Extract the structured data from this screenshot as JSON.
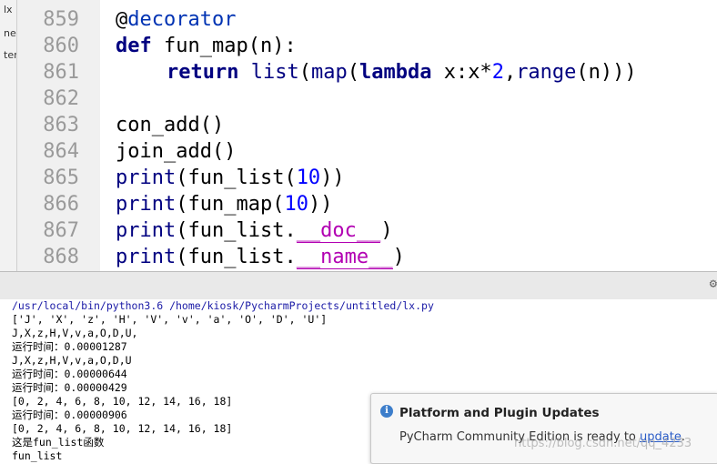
{
  "project_tree": {
    "items": [
      "lx",
      "ne",
      "ter"
    ]
  },
  "editor": {
    "line_numbers": [
      "859",
      "860",
      "861",
      "862",
      "863",
      "864",
      "865",
      "866",
      "867",
      "868"
    ],
    "lines": {
      "l859": {
        "at": "@",
        "name": "decorator"
      },
      "l860": {
        "kw": "def",
        "rest": " fun_map(n):"
      },
      "l861": {
        "kw": "return",
        "list": "list",
        "p1": "(",
        "map": "map",
        "p2": "(",
        "lambda": "lambda",
        "mid": " x:x*",
        "two": "2",
        "comma": ",",
        "range": "range",
        "end": "(n)))"
      },
      "l863": "con_add()",
      "l864": "join_add()",
      "l865": {
        "fn": "print",
        "mid": "(fun_list(",
        "num": "10",
        "end": "))"
      },
      "l866": {
        "fn": "print",
        "mid": "(fun_map(",
        "num": "10",
        "end": "))"
      },
      "l867": {
        "fn": "print",
        "mid": "(fun_list.",
        "magic": "__doc__",
        "end": ")"
      },
      "l868": {
        "fn": "print",
        "mid": "(fun_list.",
        "magic": "__name__",
        "end": ")"
      }
    }
  },
  "console": {
    "lines": [
      "/usr/local/bin/python3.6 /home/kiosk/PycharmProjects/untitled/lx.py",
      "['J', 'X', 'z', 'H', 'V', 'v', 'a', 'O', 'D', 'U']",
      "J,X,z,H,V,v,a,O,D,U,",
      "运行时间：0.00001287",
      "J,X,z,H,V,v,a,O,D,U",
      "运行时间：0.00000644",
      "运行时间：0.00000429",
      "[0, 2, 4, 6, 8, 10, 12, 14, 16, 18]",
      "运行时间：0.00000906",
      "[0, 2, 4, 6, 8, 10, 12, 14, 16, 18]",
      "这是fun_list函数",
      "fun_list"
    ]
  },
  "notification": {
    "title": "Platform and Plugin Updates",
    "body_prefix": "PyCharm Community Edition is ready to ",
    "link": "update",
    "body_suffix": "."
  },
  "watermark": "https://blog.csdn.net/qq_4233",
  "icons": {
    "gear": "gear-icon",
    "info": "info-icon"
  },
  "colors": {
    "keyword": "#000080",
    "number": "#0000ff",
    "magic": "#b200b2",
    "link": "#2a5cc7"
  }
}
